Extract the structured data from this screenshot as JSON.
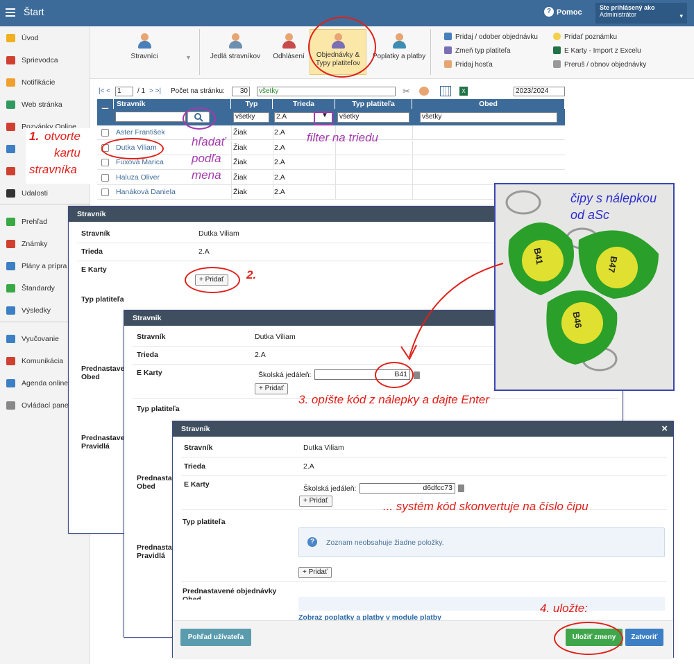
{
  "topbar": {
    "title": "Štart",
    "help": "Pomoc",
    "user_label": "Ste prihlásený ako",
    "user_role": "Administrátor"
  },
  "sidebar": {
    "items": [
      {
        "label": "Úvod",
        "icon": "star-icon",
        "color": "#f0b020"
      },
      {
        "label": "Sprievodca",
        "icon": "wand-icon",
        "color": "#d04030"
      },
      {
        "label": "Notifikácie",
        "icon": "mail-icon",
        "color": "#f0a030"
      },
      {
        "label": "Web stránka",
        "icon": "home-icon",
        "color": "#2f9a60"
      },
      {
        "label": "Pozvánky Online",
        "icon": "calendar-icon",
        "color": "#d04030"
      },
      {
        "label": "",
        "icon": "card-icon",
        "color": "#3d7fc4"
      },
      {
        "label": "",
        "icon": "person-icon",
        "color": "#d04030"
      },
      {
        "label": "Udalosti",
        "icon": "events-icon",
        "color": "#333333"
      },
      {
        "label": "Prehľad",
        "icon": "check-icon",
        "color": "#3aa845"
      },
      {
        "label": "Známky",
        "icon": "grade-icon",
        "color": "#d04030"
      },
      {
        "label": "Plány a prípra",
        "icon": "briefcase-icon",
        "color": "#3d7fc4"
      },
      {
        "label": "Štandardy",
        "icon": "shield-icon",
        "color": "#3aa845"
      },
      {
        "label": "Výsledky",
        "icon": "bars-icon",
        "color": "#3d7fc4"
      },
      {
        "label": "Vyučovanie",
        "icon": "book-icon",
        "color": "#3d7fc4"
      },
      {
        "label": "Komunikácia",
        "icon": "chat-icon",
        "color": "#d04030"
      },
      {
        "label": "Agenda online",
        "icon": "pen-icon",
        "color": "#3d7fc4"
      },
      {
        "label": "Ovládací pane",
        "icon": "gear-icon",
        "color": "#888888"
      }
    ]
  },
  "toolbar": {
    "buttons": [
      "Stravníci",
      "Jedlá stravníkov",
      "Odhlásení",
      "Objednávky &",
      "Typy platiteľov",
      "Poplatky a platby"
    ],
    "links": [
      "Pridaj / odober objednávku",
      "Zmeň typ platiteľa",
      "Pridaj hosťa",
      "Pridať poznámku",
      "E Karty - Import z Excelu",
      "Preruš / obnov objednávky"
    ]
  },
  "pager": {
    "nav": "|< <",
    "page": "1",
    "of": "/ 1",
    "nav2": "> >|",
    "per_page_label": "Počet na stránku:",
    "per_page": "30",
    "filter": "všetky",
    "year": "2023/2024"
  },
  "grid": {
    "headers": [
      "Stravník",
      "Typ",
      "Trieda",
      "Typ platiteľa",
      "Obed"
    ],
    "filters": {
      "typ": "všetky",
      "trieda": "2.A",
      "platitel": "všetky",
      "obed": "všetky"
    },
    "rows": [
      {
        "name": "Aster František",
        "type": "Žiak",
        "class": "2.A"
      },
      {
        "name": "Dutka Viliam",
        "type": "Žiak",
        "class": "2.A"
      },
      {
        "name": "Fuxová Marica",
        "type": "Žiak",
        "class": "2.A"
      },
      {
        "name": "Haluza Oliver",
        "type": "Žiak",
        "class": "2.A"
      },
      {
        "name": "Hanáková Daniela",
        "type": "Žiak",
        "class": "2.A"
      }
    ]
  },
  "dialog1": {
    "title": "Stravník",
    "labels": [
      "Stravník",
      "Trieda",
      "E Karty",
      "Typ platiteľa",
      "Prednastave",
      "Obed",
      "Prednastave",
      "Pravidlá"
    ],
    "name": "Dutka Viliam",
    "class": "2.A",
    "add": "+ Pridať"
  },
  "dialog2": {
    "title": "Stravník",
    "labels": [
      "Stravník",
      "Trieda",
      "E Karty",
      "Typ platiteľa",
      "Prednasta",
      "Obed",
      "Prednasta",
      "Pravidlá"
    ],
    "name": "Dutka Viliam",
    "class": "2.A",
    "school": "Školská jedáleň:",
    "code": "B41",
    "add": "+ Pridať"
  },
  "dialog3": {
    "title": "Stravník",
    "close": "×",
    "labels": [
      "Stravník",
      "Trieda",
      "E Karty",
      "Typ platiteľa",
      "Prednastavené objednávky",
      "Obed"
    ],
    "name": "Dutka Viliam",
    "class": "2.A",
    "school": "Školská jedáleň:",
    "chip": "d6dfcc73",
    "add": "+ Pridať",
    "info": "Zoznam neobsahuje žiadne položky.",
    "link": "Zobraz poplatky a platby v module platby",
    "view_user": "Pohľad užívateľa",
    "save": "Uložiť zmeny",
    "close_btn": "Zatvoriť"
  },
  "photo": {
    "caption1": "čipy s nálepkou",
    "caption2": "od aSc",
    "fobs": [
      "B41",
      "B47",
      "B46"
    ]
  },
  "annotations": {
    "step1a": "1.",
    "step1b": "otvorte",
    "step1c": "kartu",
    "step1d": "stravníka",
    "search_a": "hľadať",
    "search_b": "podľa",
    "search_c": "mena",
    "filter": "filter na triedu",
    "step2": "2.",
    "step3": "3. opíšte kód z nálepky a dajte Enter",
    "convert": "... systém kód skonvertuje na číslo čipu",
    "step4": "4. uložte:"
  }
}
